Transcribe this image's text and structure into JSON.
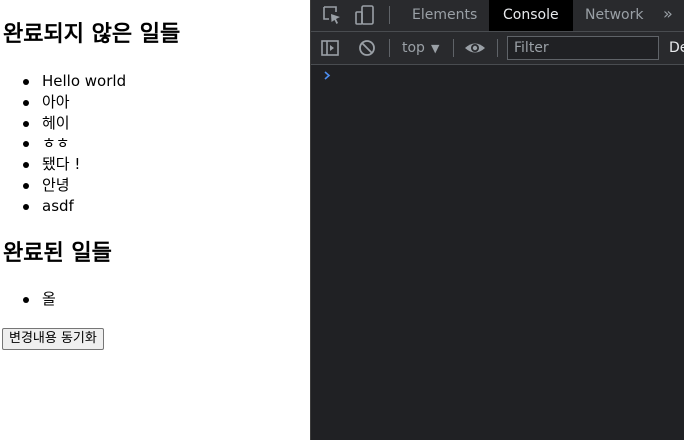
{
  "page": {
    "incomplete_heading": "완료되지 않은 일들",
    "incomplete_items": [
      "Hello world",
      "아아",
      "헤이",
      "ㅎㅎ",
      "됐다 !",
      "안녕",
      "asdf"
    ],
    "complete_heading": "완료된 일들",
    "complete_items": [
      "올"
    ],
    "sync_button_label": "변경내용 동기화"
  },
  "devtools": {
    "tabs": [
      {
        "label": "Elements",
        "active": false
      },
      {
        "label": "Console",
        "active": true
      },
      {
        "label": "Network",
        "active": false
      }
    ],
    "more_tabs": "»",
    "context": "top",
    "filter_placeholder": "Filter",
    "levels_label": "De",
    "prompt_symbol": "›",
    "colors": {
      "panel_bg": "#202124",
      "toolbar_bg": "#292a2d",
      "active_tab_bg": "#000000",
      "prompt_blue": "#4d8ef0"
    }
  }
}
